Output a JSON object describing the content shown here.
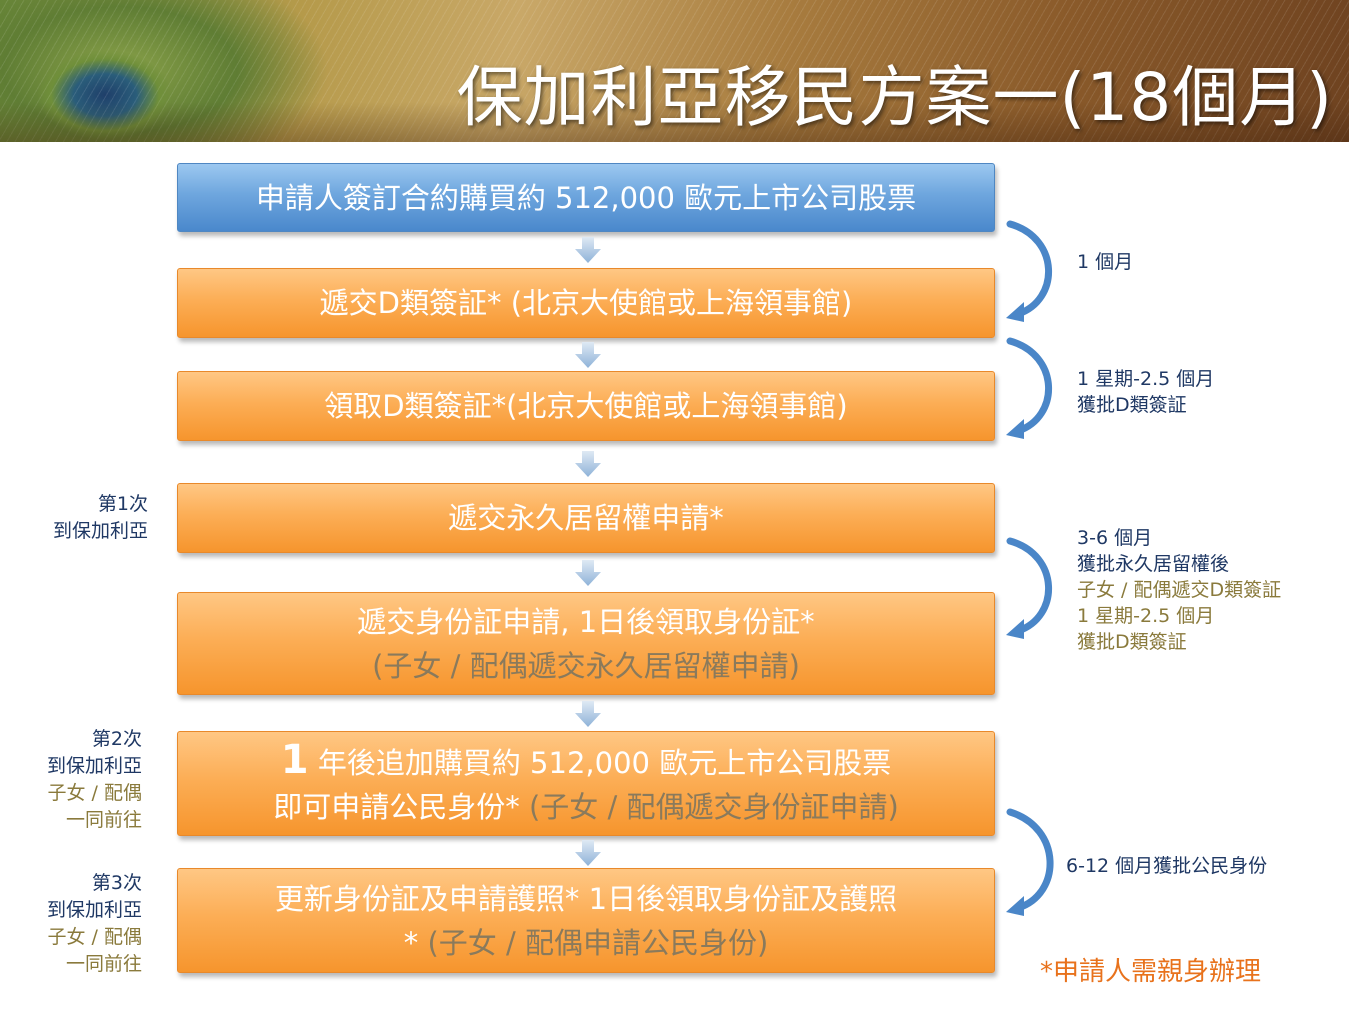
{
  "title": "保加利亞移民方案一(18個月)",
  "steps": [
    {
      "line1": "申請人簽訂合約購買約 512,000 歐元上市公司股票"
    },
    {
      "line1": "遞交D類簽証* (北京大使館或上海領事館)"
    },
    {
      "line1": "領取D類簽証*(北京大使館或上海領事館)"
    },
    {
      "line1": "遞交永久居留權申請*"
    },
    {
      "line1": "遞交身份証申請, 1日後領取身份証*",
      "line2": "(子女 / 配偶遞交永久居留權申請)"
    },
    {
      "line1_num": "1",
      "line1_rest": " 年後追加購買約 512,000 歐元上市公司股票",
      "line2_main": "即可申請公民身份* ",
      "line2_sub": "(子女 / 配偶遞交身份証申請)"
    },
    {
      "line1": "更新身份証及申請護照* 1日後領取身份証及護照",
      "line2_main": "* ",
      "line2_sub": "(子女 / 配偶申請公民身份)"
    }
  ],
  "right_notes": {
    "n1": "1 個月",
    "n2_a": "1 星期-2.5 個月",
    "n2_b": "獲批D類簽証",
    "n3_a": "3-6 個月",
    "n3_b": "獲批永久居留權後",
    "n3_c": "子女 / 配偶遞交D類簽証",
    "n3_d": "1 星期-2.5 個月",
    "n3_e": "獲批D類簽証",
    "n4": "6-12 個月獲批公民身份"
  },
  "left_notes": {
    "v1_a": "第1次",
    "v1_b": "到保加利亞",
    "v2_a": "第2次",
    "v2_b": "到保加利亞",
    "v2_c": "子女 / 配偶",
    "v2_d": "一同前往",
    "v3_a": "第3次",
    "v3_b": "到保加利亞",
    "v3_c": "子女 / 配偶",
    "v3_d": "一同前往"
  },
  "footnote": "*申請人需親身辦理",
  "colors": {
    "blue_box": "#6ea6de",
    "orange_box": "#fcae56",
    "arrow": "#4a86c8",
    "note_text": "#1f3864",
    "olive_text": "#8a7a3c",
    "footnote": "#e8721c"
  }
}
